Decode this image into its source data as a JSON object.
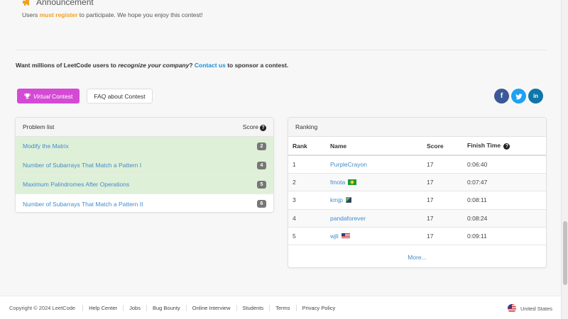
{
  "announcement": {
    "title": "Announcement",
    "text_before": "Users ",
    "text_highlight": "must register",
    "text_after": " to participate. We hope you enjoy this contest!"
  },
  "sponsor": {
    "text_1": "Want millions of LeetCode users to ",
    "text_em": "recognize your company",
    "text_2": "? ",
    "link": "Contact us",
    "text_3": " to sponsor a contest."
  },
  "buttons": {
    "virtual_em": "Virtual",
    "virtual_label": "Contest",
    "faq_label": "FAQ about Contest"
  },
  "social": {
    "facebook": "f",
    "twitter": "t",
    "linkedin": "in"
  },
  "problem_list": {
    "header": "Problem list",
    "score_header": "Score",
    "items": [
      {
        "title": "Modify the Matrix",
        "score": "2",
        "solved": true
      },
      {
        "title": "Number of Subarrays That Match a Pattern I",
        "score": "4",
        "solved": true
      },
      {
        "title": "Maximum Palindromes After Operations",
        "score": "5",
        "solved": true
      },
      {
        "title": "Number of Subarrays That Match a Pattern II",
        "score": "6",
        "solved": false
      }
    ]
  },
  "ranking": {
    "header": "Ranking",
    "columns": {
      "rank": "Rank",
      "name": "Name",
      "score": "Score",
      "finish": "Finish Time"
    },
    "rows": [
      {
        "rank": "1",
        "name": "PurpleCrayon",
        "flag": "",
        "score": "17",
        "finish": "0:06:40"
      },
      {
        "rank": "2",
        "name": "fmota",
        "flag": "brazil-flag-icon",
        "score": "17",
        "finish": "0:07:47"
      },
      {
        "rank": "3",
        "name": "kmjp",
        "flag": "cube-icon",
        "score": "17",
        "finish": "0:08:11"
      },
      {
        "rank": "4",
        "name": "pandaforever",
        "flag": "",
        "score": "17",
        "finish": "0:08:24"
      },
      {
        "rank": "5",
        "name": "wjli",
        "flag": "us-flag-icon",
        "score": "17",
        "finish": "0:09:11"
      }
    ],
    "more": "More..."
  },
  "footer": {
    "copyright": "Copyright © 2024 LeetCode",
    "links": [
      "Help Center",
      "Jobs",
      "Bug Bounty",
      "Online Interview",
      "Students",
      "Terms",
      "Privacy Policy"
    ],
    "region": "United States"
  },
  "colors": {
    "accent_orange": "#f0a020",
    "link_blue": "#428bca",
    "virtual_button": "#d54ad5",
    "solved_row": "#dff0d8"
  }
}
